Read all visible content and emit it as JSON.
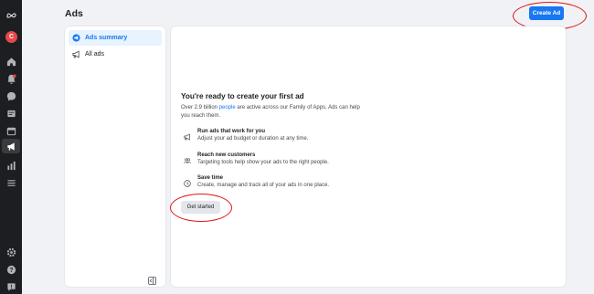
{
  "header": {
    "title": "Ads",
    "create_ad_label": "Create Ad"
  },
  "rail": {
    "avatar_letter": "C",
    "icons": [
      "meta-logo-icon",
      "home-icon",
      "notifications-icon",
      "messages-icon",
      "pages-icon",
      "calendar-icon",
      "ads-icon",
      "insights-icon",
      "menu-icon",
      "settings-icon",
      "help-icon",
      "feedback-icon"
    ]
  },
  "sidebar": {
    "items": [
      {
        "label": "Ads summary",
        "icon": "ads-summary-icon",
        "active": true
      },
      {
        "label": "All ads",
        "icon": "megaphone-icon",
        "active": false
      }
    ]
  },
  "main": {
    "heading": "You're ready to create your first ad",
    "intro_before": "Over 2.9 billion ",
    "intro_link": "people",
    "intro_after": " are active across our Family of Apps. Ads can help you reach them.",
    "features": [
      {
        "title": "Run ads that work for you",
        "desc": "Adjust your ad budget or duration at any time.",
        "icon": "megaphone-icon"
      },
      {
        "title": "Reach new customers",
        "desc": "Targeting tools help show your ads to the right people.",
        "icon": "people-icon"
      },
      {
        "title": "Save time",
        "desc": "Create, manage and track all of your ads in one place.",
        "icon": "clock-icon"
      }
    ],
    "get_started_label": "Get started"
  },
  "colors": {
    "accent": "#1877f2",
    "annotation": "#e0151b",
    "rail": "#1c1e21"
  }
}
